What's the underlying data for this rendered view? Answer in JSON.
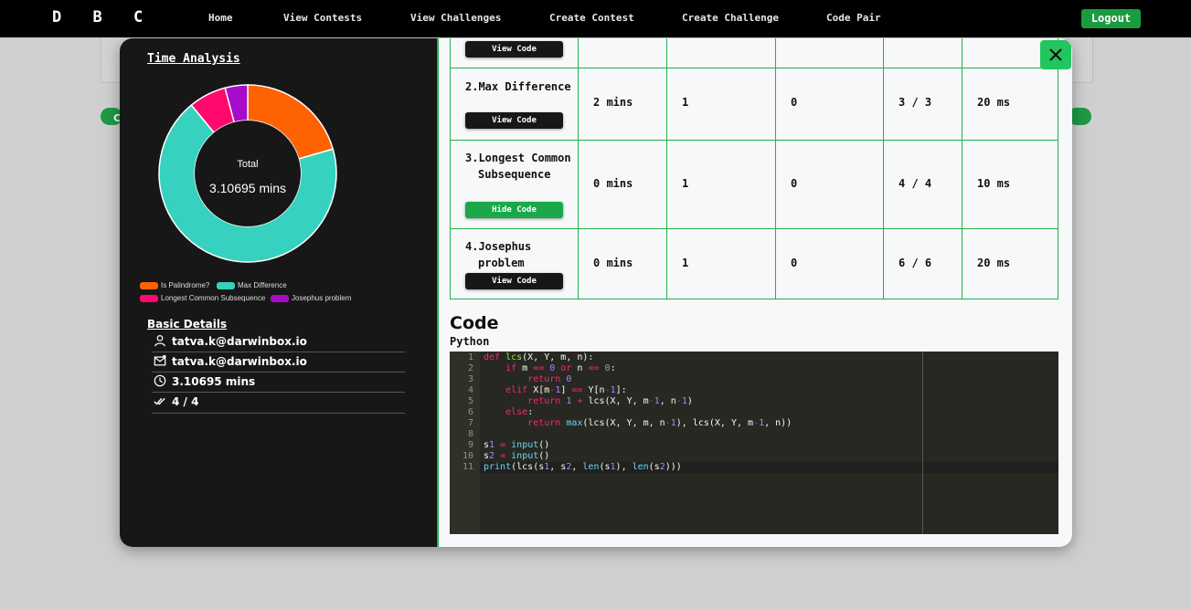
{
  "navbar": {
    "brand": "D B C",
    "links": [
      "Home",
      "View Contests",
      "View Challenges",
      "Create Contest",
      "Create Challenge",
      "Code Pair"
    ],
    "logout_label": "Logout"
  },
  "background": {
    "pill_letter": "C"
  },
  "time_analysis": {
    "title": "Time Analysis",
    "center_label": "Total",
    "center_value": "3.10695 mins",
    "legend": [
      {
        "label": "Is Palindrome?",
        "color": "#ff6200"
      },
      {
        "label": "Max Difference",
        "color": "#37d1bf"
      },
      {
        "label": "Longest Common Subsequence",
        "color": "#ff0a6c"
      },
      {
        "label": "Josephus problem",
        "color": "#a80bc9"
      }
    ]
  },
  "chart_data": {
    "type": "pie",
    "categories": [
      "Is Palindrome?",
      "Max Difference",
      "Longest Common Subsequence",
      "Josephus problem"
    ],
    "values": [
      0.6,
      2.0,
      0.2,
      0.12
    ],
    "colors": [
      "#ff6200",
      "#37d1bf",
      "#ff0a6c",
      "#a80bc9"
    ],
    "title": "",
    "total_label": "3.10695 mins"
  },
  "basic_details": {
    "title": "Basic Details",
    "name": "tatva.k@darwinbox.io",
    "email": "tatva.k@darwinbox.io",
    "total_time": "3.10695 mins",
    "solved": "4 / 4"
  },
  "table": {
    "rows": [
      {
        "problem": "",
        "button": "View Code",
        "time": "",
        "attempts": "",
        "wrong": "",
        "tests": "",
        "runtime": ""
      },
      {
        "problem": "2.Max Difference",
        "button": "View Code",
        "time": "2 mins",
        "attempts": "1",
        "wrong": "0",
        "tests": "3 / 3",
        "runtime": "20 ms"
      },
      {
        "problem": "3.Longest Common Subsequence",
        "button": "Hide Code",
        "time": "0 mins",
        "attempts": "1",
        "wrong": "0",
        "tests": "4 / 4",
        "runtime": "10 ms"
      },
      {
        "problem": "4.Josephus problem",
        "button": "View Code",
        "time": "0 mins",
        "attempts": "1",
        "wrong": "0",
        "tests": "6 / 6",
        "runtime": "20 ms"
      }
    ]
  },
  "code": {
    "heading": "Code",
    "language": "Python",
    "lines": [
      "def lcs(X, Y, m, n):",
      "    if m == 0 or n == 0:",
      "        return 0",
      "    elif X[m-1] == Y[n-1]:",
      "        return 1 + lcs(X, Y, m-1, n-1)",
      "    else:",
      "        return max(lcs(X, Y, m, n-1), lcs(X, Y, m-1, n))",
      "",
      "s1 = input()",
      "s2 = input()",
      "print(lcs(s1, s2, len(s1), len(s2)))"
    ]
  },
  "close_icon": "close-icon"
}
